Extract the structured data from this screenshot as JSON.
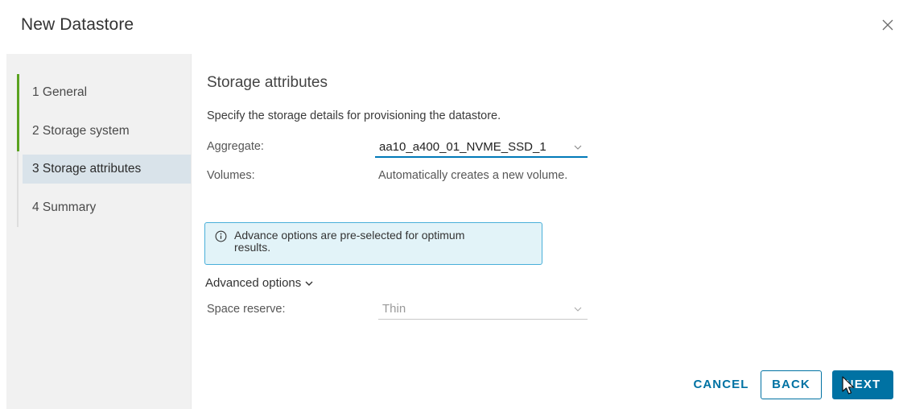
{
  "dialog": {
    "title": "New Datastore"
  },
  "wizard": {
    "steps": [
      {
        "label": "1  General",
        "state": "completed"
      },
      {
        "label": "2  Storage system",
        "state": "completed"
      },
      {
        "label": "3  Storage attributes",
        "state": "active"
      },
      {
        "label": "4  Summary",
        "state": "pending"
      }
    ]
  },
  "content": {
    "title": "Storage attributes",
    "description": "Specify the storage details for provisioning the datastore.",
    "aggregate": {
      "label": "Aggregate:",
      "value": "aa10_a400_01_NVME_SSD_1"
    },
    "volumes": {
      "label": "Volumes:",
      "value": "Automatically creates a new volume."
    },
    "info": {
      "text": "Advance options are pre-selected for optimum results."
    },
    "advanced": {
      "toggle_label": "Advanced options",
      "space_reserve": {
        "label": "Space reserve:",
        "value": "Thin"
      }
    }
  },
  "footer": {
    "cancel_label": "CANCEL",
    "back_label": "BACK",
    "next_label": "NEXT"
  },
  "colors": {
    "primary": "#0072a3",
    "completed_step": "#5aa220",
    "info_bg": "#e2f3f8",
    "info_border": "#49afd9",
    "nav_active_bg": "#d9e3ea"
  },
  "icons": {
    "close": "close-icon",
    "caret": "chevron-down-icon",
    "info": "info-circle-icon"
  }
}
